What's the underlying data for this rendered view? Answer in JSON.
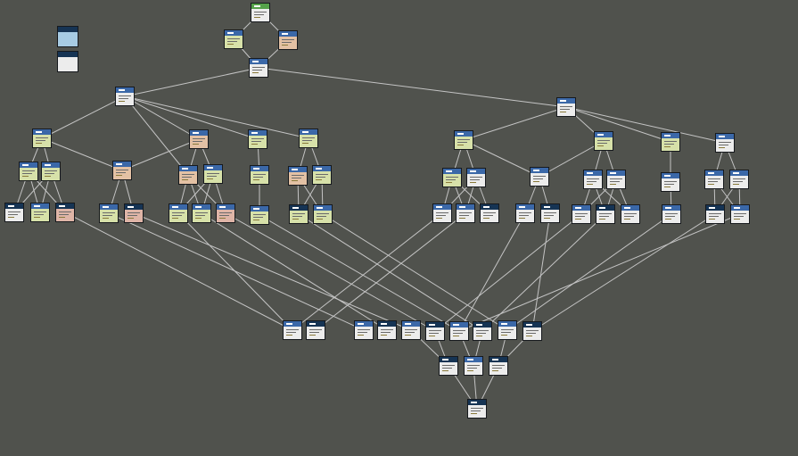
{
  "colors": {
    "background": "#50524d",
    "edge": "#c4c4c4",
    "header_default": "#3b68a8",
    "header_dark": "#163454",
    "header_root": "#55a24a",
    "body_white": "#ececec",
    "body_yellow": "#d7e1a9",
    "body_peach": "#e3c1a4",
    "body_pink": "#dfb5a7",
    "body_lightblue": "#a7cbe3"
  },
  "legend": [
    {
      "header": "header_dark",
      "body": "body_lightblue"
    },
    {
      "header": "header_dark",
      "body": "body_white"
    }
  ],
  "nodes": [
    {
      "id": "n0",
      "header": "header_root",
      "body": "body_white"
    },
    {
      "id": "n1",
      "header": "header_default",
      "body": "body_yellow"
    },
    {
      "id": "n2",
      "header": "header_default",
      "body": "body_peach"
    },
    {
      "id": "n3",
      "header": "header_default",
      "body": "body_white"
    },
    {
      "id": "n4",
      "header": "header_default",
      "body": "body_white"
    },
    {
      "id": "n5",
      "header": "header_default",
      "body": "body_white"
    },
    {
      "id": "n6",
      "header": "header_default",
      "body": "body_yellow"
    },
    {
      "id": "n7",
      "header": "header_default",
      "body": "body_peach"
    },
    {
      "id": "n8",
      "header": "header_default",
      "body": "body_yellow"
    },
    {
      "id": "n9",
      "header": "header_default",
      "body": "body_yellow"
    },
    {
      "id": "n10",
      "header": "header_default",
      "body": "body_yellow"
    },
    {
      "id": "n11",
      "header": "header_default",
      "body": "body_yellow"
    },
    {
      "id": "n12",
      "header": "header_default",
      "body": "body_peach"
    },
    {
      "id": "n13",
      "header": "header_default",
      "body": "body_peach"
    },
    {
      "id": "n14",
      "header": "header_default",
      "body": "body_yellow"
    },
    {
      "id": "n15",
      "header": "header_default",
      "body": "body_yellow"
    },
    {
      "id": "n16",
      "header": "header_default",
      "body": "body_peach"
    },
    {
      "id": "n17",
      "header": "header_default",
      "body": "body_yellow"
    },
    {
      "id": "n18",
      "header": "header_default",
      "body": "body_peach"
    },
    {
      "id": "n19",
      "header": "header_dark",
      "body": "body_white"
    },
    {
      "id": "n20",
      "header": "header_default",
      "body": "body_yellow"
    },
    {
      "id": "n21",
      "header": "header_dark",
      "body": "body_pink"
    },
    {
      "id": "n22",
      "header": "header_default",
      "body": "body_yellow"
    },
    {
      "id": "n23",
      "header": "header_dark",
      "body": "body_pink"
    },
    {
      "id": "n24",
      "header": "header_default",
      "body": "body_yellow"
    },
    {
      "id": "n25",
      "header": "header_default",
      "body": "body_yellow"
    },
    {
      "id": "n26",
      "header": "header_default",
      "body": "body_pink"
    },
    {
      "id": "n27",
      "header": "header_default",
      "body": "body_yellow"
    },
    {
      "id": "n28",
      "header": "header_dark",
      "body": "body_yellow"
    },
    {
      "id": "n29",
      "header": "header_default",
      "body": "body_yellow"
    },
    {
      "id": "n30",
      "header": "header_default",
      "body": "body_yellow"
    },
    {
      "id": "n31",
      "header": "header_default",
      "body": "body_yellow"
    },
    {
      "id": "n32",
      "header": "header_default",
      "body": "body_yellow"
    },
    {
      "id": "n33",
      "header": "header_default",
      "body": "body_white"
    },
    {
      "id": "n34",
      "header": "header_default",
      "body": "body_yellow"
    },
    {
      "id": "n35",
      "header": "header_default",
      "body": "body_white"
    },
    {
      "id": "n36",
      "header": "header_default",
      "body": "body_white"
    },
    {
      "id": "n37",
      "header": "header_default",
      "body": "body_white"
    },
    {
      "id": "n38",
      "header": "header_default",
      "body": "body_white"
    },
    {
      "id": "n39",
      "header": "header_default",
      "body": "body_white"
    },
    {
      "id": "n40",
      "header": "header_default",
      "body": "body_white"
    },
    {
      "id": "n41",
      "header": "header_default",
      "body": "body_white"
    },
    {
      "id": "n42",
      "header": "header_default",
      "body": "body_white"
    },
    {
      "id": "n43",
      "header": "header_default",
      "body": "body_white"
    },
    {
      "id": "n44",
      "header": "header_dark",
      "body": "body_white"
    },
    {
      "id": "n45",
      "header": "header_default",
      "body": "body_white"
    },
    {
      "id": "n46",
      "header": "header_dark",
      "body": "body_white"
    },
    {
      "id": "n47",
      "header": "header_default",
      "body": "body_white"
    },
    {
      "id": "n48",
      "header": "header_dark",
      "body": "body_white"
    },
    {
      "id": "n49",
      "header": "header_default",
      "body": "body_white"
    },
    {
      "id": "n50",
      "header": "header_default",
      "body": "body_white"
    },
    {
      "id": "n51",
      "header": "header_dark",
      "body": "body_white"
    },
    {
      "id": "n52",
      "header": "header_default",
      "body": "body_white"
    },
    {
      "id": "n53",
      "header": "header_default",
      "body": "body_white"
    },
    {
      "id": "n54",
      "header": "header_dark",
      "body": "body_white"
    },
    {
      "id": "n55",
      "header": "header_default",
      "body": "body_white"
    },
    {
      "id": "n56",
      "header": "header_dark",
      "body": "body_white"
    },
    {
      "id": "n57",
      "header": "header_default",
      "body": "body_white"
    },
    {
      "id": "n58",
      "header": "header_dark",
      "body": "body_white"
    },
    {
      "id": "n59",
      "header": "header_default",
      "body": "body_white"
    },
    {
      "id": "n60",
      "header": "header_dark",
      "body": "body_white"
    },
    {
      "id": "n61",
      "header": "header_default",
      "body": "body_white"
    },
    {
      "id": "n62",
      "header": "header_dark",
      "body": "body_white"
    },
    {
      "id": "n63",
      "header": "header_dark",
      "body": "body_white"
    },
    {
      "id": "n64",
      "header": "header_default",
      "body": "body_white"
    },
    {
      "id": "n65",
      "header": "header_dark",
      "body": "body_white"
    },
    {
      "id": "n66",
      "header": "header_default",
      "body": "body_white"
    },
    {
      "id": "n67",
      "header": "header_dark",
      "body": "body_white"
    },
    {
      "id": "n68",
      "header": "header_default",
      "body": "body_white"
    },
    {
      "id": "n69",
      "header": "header_default",
      "body": "body_white"
    },
    {
      "id": "n70",
      "header": "header_default",
      "body": "body_white"
    },
    {
      "id": "n71",
      "header": "header_default",
      "body": "body_white"
    },
    {
      "id": "n72",
      "header": "header_default",
      "body": "body_white"
    },
    {
      "id": "n73",
      "header": "header_dark",
      "body": "body_white"
    }
  ],
  "edges": [
    [
      "n0",
      "n1"
    ],
    [
      "n0",
      "n2"
    ],
    [
      "n1",
      "n3"
    ],
    [
      "n2",
      "n3"
    ],
    [
      "n3",
      "n4"
    ],
    [
      "n3",
      "n5"
    ],
    [
      "n4",
      "n6"
    ],
    [
      "n4",
      "n7"
    ],
    [
      "n4",
      "n8"
    ],
    [
      "n4",
      "n9"
    ],
    [
      "n6",
      "n10"
    ],
    [
      "n6",
      "n11"
    ],
    [
      "n6",
      "n12"
    ],
    [
      "n7",
      "n10"
    ],
    [
      "n7",
      "n11"
    ],
    [
      "n8",
      "n13"
    ],
    [
      "n9",
      "n14"
    ],
    [
      "n10",
      "n19"
    ],
    [
      "n10",
      "n20"
    ],
    [
      "n10",
      "n21"
    ],
    [
      "n11",
      "n19"
    ],
    [
      "n11",
      "n20"
    ],
    [
      "n11",
      "n21"
    ],
    [
      "n12",
      "n22"
    ],
    [
      "n12",
      "n23"
    ],
    [
      "n7",
      "n24"
    ],
    [
      "n7",
      "n25"
    ],
    [
      "n7",
      "n26"
    ],
    [
      "n13",
      "n24"
    ],
    [
      "n13",
      "n25"
    ],
    [
      "n13",
      "n26"
    ],
    [
      "n8",
      "n27"
    ],
    [
      "n9",
      "n28"
    ],
    [
      "n9",
      "n29"
    ],
    [
      "n14",
      "n28"
    ],
    [
      "n14",
      "n29"
    ],
    [
      "n5",
      "n30"
    ],
    [
      "n5",
      "n31"
    ],
    [
      "n5",
      "n32"
    ],
    [
      "n5",
      "n33"
    ],
    [
      "n30",
      "n34"
    ],
    [
      "n30",
      "n35"
    ],
    [
      "n30",
      "n36"
    ],
    [
      "n31",
      "n37"
    ],
    [
      "n31",
      "n38"
    ],
    [
      "n32",
      "n39"
    ],
    [
      "n33",
      "n40"
    ],
    [
      "n33",
      "n41"
    ],
    [
      "n34",
      "n42"
    ],
    [
      "n35",
      "n42"
    ],
    [
      "n35",
      "n43"
    ],
    [
      "n36",
      "n44"
    ],
    [
      "n37",
      "n45"
    ],
    [
      "n37",
      "n46"
    ],
    [
      "n38",
      "n47"
    ],
    [
      "n38",
      "n48"
    ],
    [
      "n39",
      "n49"
    ],
    [
      "n40",
      "n50"
    ],
    [
      "n41",
      "n51"
    ],
    [
      "n19",
      "n52"
    ],
    [
      "n21",
      "n53"
    ],
    [
      "n22",
      "n54"
    ],
    [
      "n23",
      "n55"
    ],
    [
      "n24",
      "n56"
    ],
    [
      "n25",
      "n57"
    ],
    [
      "n26",
      "n58"
    ],
    [
      "n27",
      "n59"
    ],
    [
      "n28",
      "n60"
    ],
    [
      "n29",
      "n61"
    ],
    [
      "n42",
      "n52"
    ],
    [
      "n43",
      "n53"
    ],
    [
      "n44",
      "n56"
    ],
    [
      "n45",
      "n57"
    ],
    [
      "n46",
      "n58"
    ],
    [
      "n47",
      "n59"
    ],
    [
      "n49",
      "n60"
    ],
    [
      "n50",
      "n61"
    ],
    [
      "n57",
      "n62"
    ],
    [
      "n58",
      "n62"
    ],
    [
      "n58",
      "n63"
    ],
    [
      "n59",
      "n63"
    ],
    [
      "n60",
      "n64"
    ],
    [
      "n61",
      "n64"
    ],
    [
      "n62",
      "n73"
    ],
    [
      "n63",
      "n73"
    ],
    [
      "n64",
      "n73"
    ]
  ]
}
